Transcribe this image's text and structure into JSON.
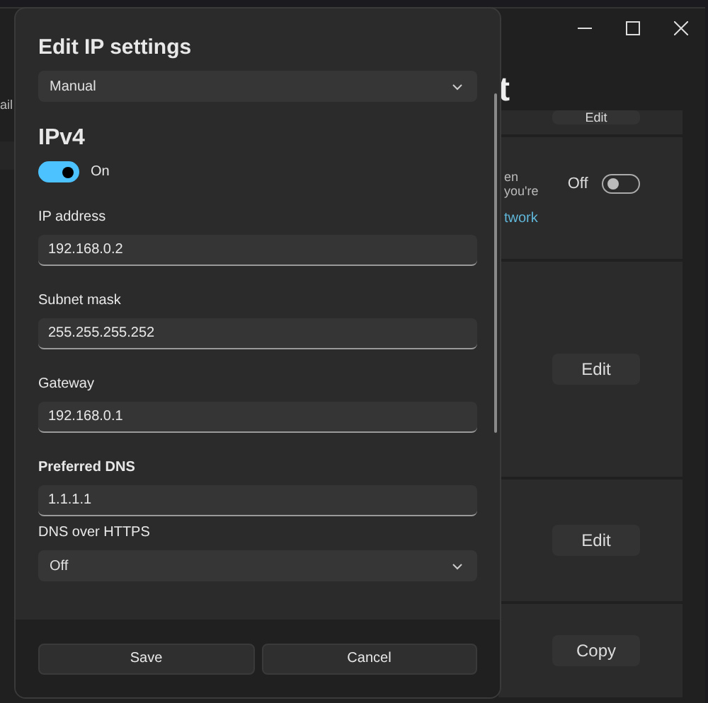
{
  "background": {
    "side_text": "ail",
    "heading": "t",
    "cards": [
      {
        "kind": "button",
        "label": "Edit"
      },
      {
        "kind": "toggle",
        "text": "en you're",
        "state_label": "Off",
        "on": false,
        "link": "twork"
      },
      {
        "kind": "button",
        "label": "Edit"
      },
      {
        "kind": "button",
        "label": "Edit"
      },
      {
        "kind": "button",
        "label": "Copy"
      }
    ]
  },
  "dialog": {
    "title": "Edit IP settings",
    "mode": "Manual",
    "section": "IPv4",
    "ipv4": {
      "on": true,
      "label": "On"
    },
    "fields": [
      {
        "kind": "text",
        "label": "IP address",
        "value": "192.168.0.2"
      },
      {
        "kind": "text",
        "label": "Subnet mask",
        "value": "255.255.255.252"
      },
      {
        "kind": "text",
        "label": "Gateway",
        "value": "192.168.0.1"
      },
      {
        "kind": "text",
        "label": "Preferred DNS",
        "value": "1.1.1.1"
      },
      {
        "kind": "select",
        "label": "DNS over HTTPS",
        "value": "Off"
      }
    ],
    "buttons": [
      "Save",
      "Cancel"
    ]
  }
}
